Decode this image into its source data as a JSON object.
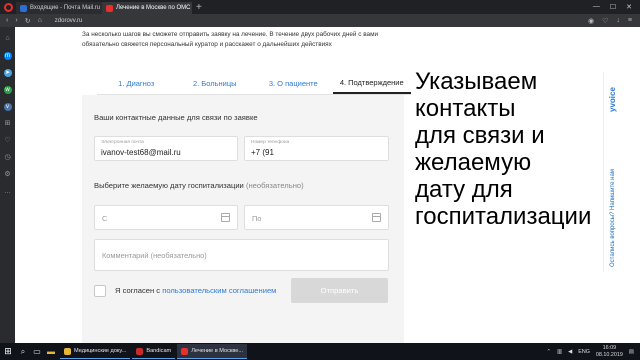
{
  "browser": {
    "tabs": [
      {
        "label": "Входящие - Почта Mail.ru",
        "favicon_color": "#2b6fd6"
      },
      {
        "label": "Лечение в Москве по ОМС",
        "favicon_color": "#e8302c"
      }
    ],
    "url": "zdorovv.ru"
  },
  "page": {
    "intro": "За несколько шагов вы сможете отправить заявку на лечение. В течение двух рабочих дней с вами обязательно свяжется персональный куратор и расскажет о дальнейших действиях",
    "steps": [
      "1. Диагноз",
      "2. Больницы",
      "3. О пациенте",
      "4. Подтверждение"
    ],
    "contact_heading": "Ваши контактные данные для связи по заявке",
    "email": {
      "label": "Электронная почта",
      "value": "ivanov-test68@mail.ru"
    },
    "phone": {
      "label": "Номер телефона",
      "value": "+7 (91"
    },
    "date_heading": "Выберите желаемую дату госпитализации",
    "date_heading_optional": "(необязательно)",
    "date_from_placeholder": "С",
    "date_to_placeholder": "По",
    "comment_placeholder": "Комментарий (необязательно)",
    "agree_text": "Я согласен с",
    "agree_link": "пользовательским соглашением",
    "submit_label": "Отправить"
  },
  "caption": {
    "lines": [
      "Указываем",
      "контакты",
      "для связи и",
      "желаемую",
      "дату для",
      "госпитализации"
    ]
  },
  "side_widget": {
    "brand": "yvoice",
    "text": "Остались вопросы? Напишите нам"
  },
  "taskbar": {
    "apps": [
      {
        "label": "Медицинские доку...",
        "color": "#e7b73a"
      },
      {
        "label": "Bandicam",
        "color": "#c92a2a"
      },
      {
        "label": "Лечение в Москве...",
        "color": "#e8302c"
      }
    ],
    "lang": "ENG",
    "time": "16:09",
    "date": "08.10.2019"
  }
}
